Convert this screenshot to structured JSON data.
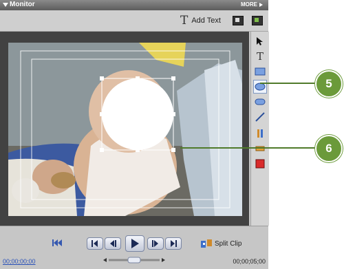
{
  "window": {
    "title": "Monitor",
    "more_label": "MORE"
  },
  "toolbar": {
    "add_text_label": "Add Text"
  },
  "player": {
    "current_timecode": "00;00;00;00",
    "duration_timecode": "00;00;05;00"
  },
  "split_clip": {
    "label": "Split Clip"
  },
  "tools": [
    "pointer-icon",
    "text-tool-icon",
    "rectangle-icon",
    "ellipse-icon",
    "rounded-rectangle-icon",
    "line-icon",
    "motion-path-icon",
    "color-fill-icon",
    "stroke-color-icon"
  ],
  "callouts": [
    {
      "number": "5"
    },
    {
      "number": "6"
    }
  ],
  "colors": {
    "callout": "#6b9a3a",
    "selection_handles": "#ffffff",
    "panel": "#c9c9c9",
    "stage": "#424242"
  }
}
